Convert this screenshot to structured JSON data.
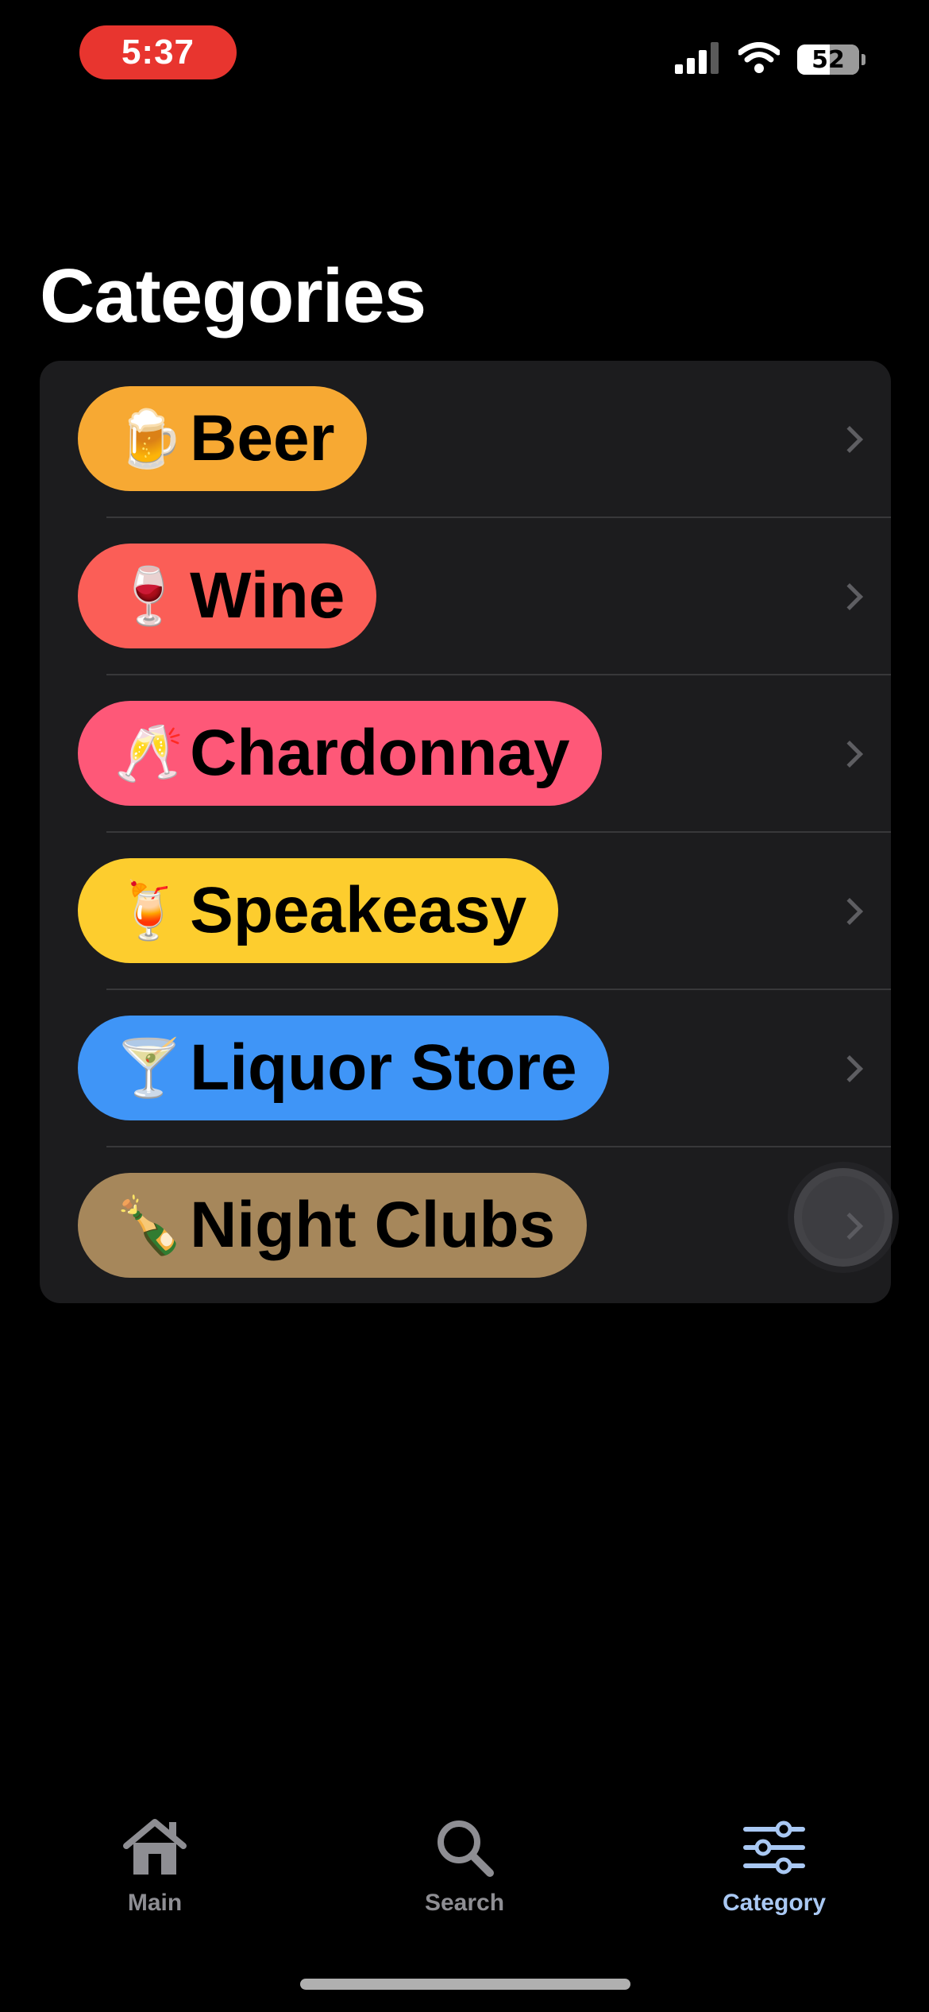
{
  "status_bar": {
    "time": "5:37",
    "battery": "52",
    "battery_fraction": 0.52
  },
  "page": {
    "title": "Categories"
  },
  "categories": [
    {
      "emoji": "🍺",
      "label": "Beer",
      "color": "#f7a933"
    },
    {
      "emoji": "🍷",
      "label": "Wine",
      "color": "#fb5e57"
    },
    {
      "emoji": "🥂",
      "label": "Chardonnay",
      "color": "#fe5878"
    },
    {
      "emoji": "🍹",
      "label": "Speakeasy",
      "color": "#fdcd2e"
    },
    {
      "emoji": "🍸",
      "label": "Liquor Store",
      "color": "#3f95f7"
    },
    {
      "emoji": "🍾",
      "label": "Night Clubs",
      "color": "#a6875b"
    }
  ],
  "tab_bar": {
    "tabs": [
      {
        "label": "Main",
        "icon": "house-icon",
        "active": false
      },
      {
        "label": "Search",
        "icon": "magnifying-glass-icon",
        "active": false
      },
      {
        "label": "Category",
        "icon": "sliders-icon",
        "active": true
      }
    ],
    "inactive_color": "#8e8e93",
    "active_color": "#a9c8f3"
  }
}
